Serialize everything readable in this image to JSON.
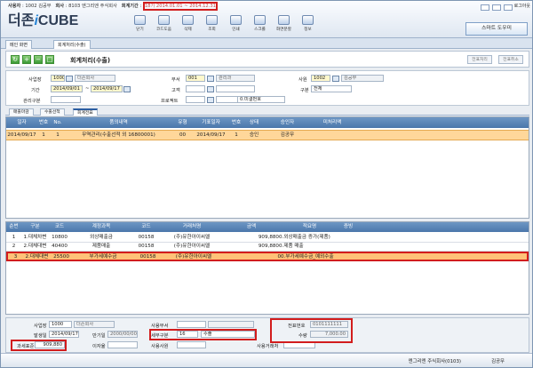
{
  "app": {
    "logo_left": "더존",
    "logo_i": "i",
    "logo_right": "CUBE",
    "user_label": "사용자",
    "user_value": "1002 김공무",
    "company_label": "회사",
    "company_value": "8103 엔그리엔 주식회사",
    "period_label": "회계기간",
    "period_value": "18기 2014.01.01 ~ 2014.12.31"
  },
  "top": {
    "logout": "로그아웃",
    "smart_helper": "스마트 도우미",
    "toolbar": [
      "닫기",
      "코드도움",
      "삭제",
      "조회",
      "인쇄",
      "스크롤",
      "화면분할",
      "정보"
    ]
  },
  "tabs": {
    "home": "메인 화면",
    "current": "회계처리(수출)"
  },
  "page": {
    "title": "회계처리(수출)",
    "button_transfer": "전표처리",
    "button_cancel": "전표취소"
  },
  "filters": {
    "business_label": "사업장",
    "business_code": "1000",
    "business_name": "더존회사",
    "dept_label": "부서",
    "dept_code": "001",
    "dept_name": "관리과",
    "employee_label": "사원",
    "employee_code": "1002",
    "employee_name": "김공무",
    "period_label": "기간",
    "period_from": "2014/09/01",
    "period_to": "2014/09/17",
    "period_sep": "~",
    "customer_label": "고객",
    "div_label": "구분",
    "div_value": "전체",
    "mgmt_label": "관리구분",
    "project_label": "프로젝트",
    "pending_value": "0.미결번호"
  },
  "subtabs": [
    "매출마감",
    "수출선적",
    "회계전표"
  ],
  "top_grid": {
    "headers": [
      "일자",
      "번호",
      "No.",
      "품의내역",
      "유형",
      "기표일자",
      "번호",
      "상태",
      "승인자",
      "미처리액"
    ],
    "rows": [
      [
        "2014/09/17",
        "1",
        "1",
        "무역관리(수출선적 외 16800001)",
        "00",
        "2014/09/17",
        "1",
        "승인",
        "김공무",
        ""
      ]
    ]
  },
  "bottom_grid": {
    "headers": [
      "순번",
      "구분",
      "코드",
      "계정과목",
      "코드",
      "거래처명",
      "금액",
      "적요명",
      "증빙"
    ],
    "rows": [
      [
        "1",
        "1.대체차변",
        "10800",
        "외상매출금",
        "00158",
        "(주)유한아이씨엘",
        "909,880",
        "0.외상매출금 증가(제품)",
        ""
      ],
      [
        "2",
        "2.대체대변",
        "40400",
        "제품매출",
        "00158",
        "(주)유한아이씨엘",
        "909,880",
        "0.제품 매출",
        ""
      ],
      [
        "3",
        "2.대체대변",
        "25500",
        "부가세예수금",
        "00158",
        "(주)유한아이씨엘",
        "0",
        "0.부가세예수금_예외수출",
        ""
      ]
    ]
  },
  "bottom": {
    "biz_label": "사업장",
    "biz_code": "1000",
    "biz_name": "더존회사",
    "date_label": "발생일",
    "date_value": "2014/09/17",
    "due_label": "만기일",
    "due_value": "2000/00/00",
    "tax_label": "과세표준",
    "tax_value": "909,880",
    "interest_label": "이자율",
    "dept_label": "사용부서",
    "tax_type_label": "세무구분",
    "tax_type_code": "16",
    "tax_type_name": "수출",
    "user_label": "사용사원",
    "user2_label": "사용거래처",
    "approval_label": "전표번호",
    "approval_value": "0101111111",
    "qty_label": "수량",
    "qty_value": "7,000.00"
  },
  "status": {
    "company": "엔그리엔 주식회사(0103)",
    "user": "김공무"
  }
}
